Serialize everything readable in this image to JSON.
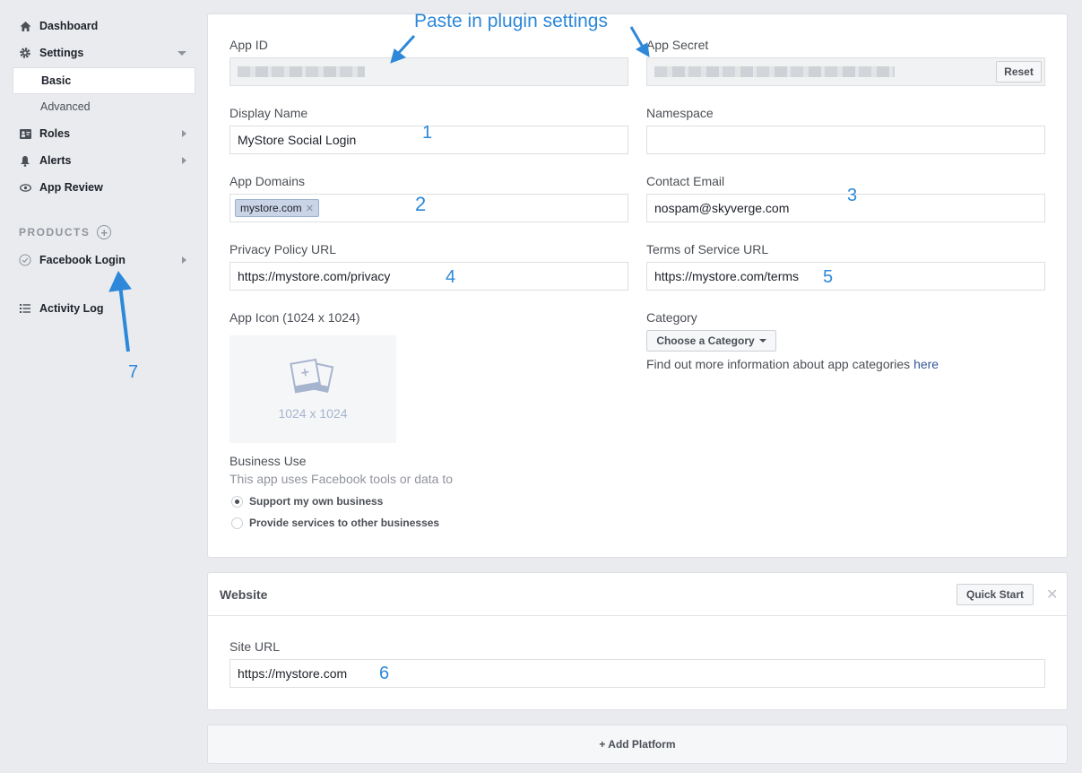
{
  "sidebar": {
    "dashboard": "Dashboard",
    "settings": "Settings",
    "basic": "Basic",
    "advanced": "Advanced",
    "roles": "Roles",
    "alerts": "Alerts",
    "app_review": "App Review",
    "products_header": "PRODUCTS",
    "facebook_login": "Facebook Login",
    "activity_log": "Activity Log"
  },
  "basic": {
    "app_id_label": "App ID",
    "app_id_value": "",
    "app_secret_label": "App Secret",
    "app_secret_value": "",
    "reset_button": "Reset",
    "display_name_label": "Display Name",
    "display_name_value": "MyStore Social Login",
    "namespace_label": "Namespace",
    "namespace_value": "",
    "app_domains_label": "App Domains",
    "app_domains_tags": [
      "mystore.com"
    ],
    "contact_email_label": "Contact Email",
    "contact_email_value": "nospam@skyverge.com",
    "privacy_url_label": "Privacy Policy URL",
    "privacy_url_value": "https://mystore.com/privacy",
    "terms_url_label": "Terms of Service URL",
    "terms_url_value": "https://mystore.com/terms",
    "app_icon_label": "App Icon (1024 x 1024)",
    "app_icon_placeholder": "1024 x 1024",
    "category_label": "Category",
    "category_button": "Choose a Category",
    "category_help": "Find out more information about app categories ",
    "category_help_link": "here",
    "business_use_label": "Business Use",
    "business_use_desc": "This app uses Facebook tools or data to",
    "business_options": [
      {
        "label": "Support my own business",
        "selected": true
      },
      {
        "label": "Provide services to other businesses",
        "selected": false
      }
    ]
  },
  "website": {
    "title": "Website",
    "quick_start": "Quick Start",
    "site_url_label": "Site URL",
    "site_url_value": "https://mystore.com"
  },
  "add_platform": "+ Add Platform",
  "annotations": {
    "paste": "Paste in plugin settings",
    "n1": "1",
    "n2": "2",
    "n3": "3",
    "n4": "4",
    "n5": "5",
    "n6": "6",
    "n7": "7"
  },
  "colors": {
    "annotation": "#2d88d9",
    "link": "#365899",
    "background": "#e9ebee"
  }
}
